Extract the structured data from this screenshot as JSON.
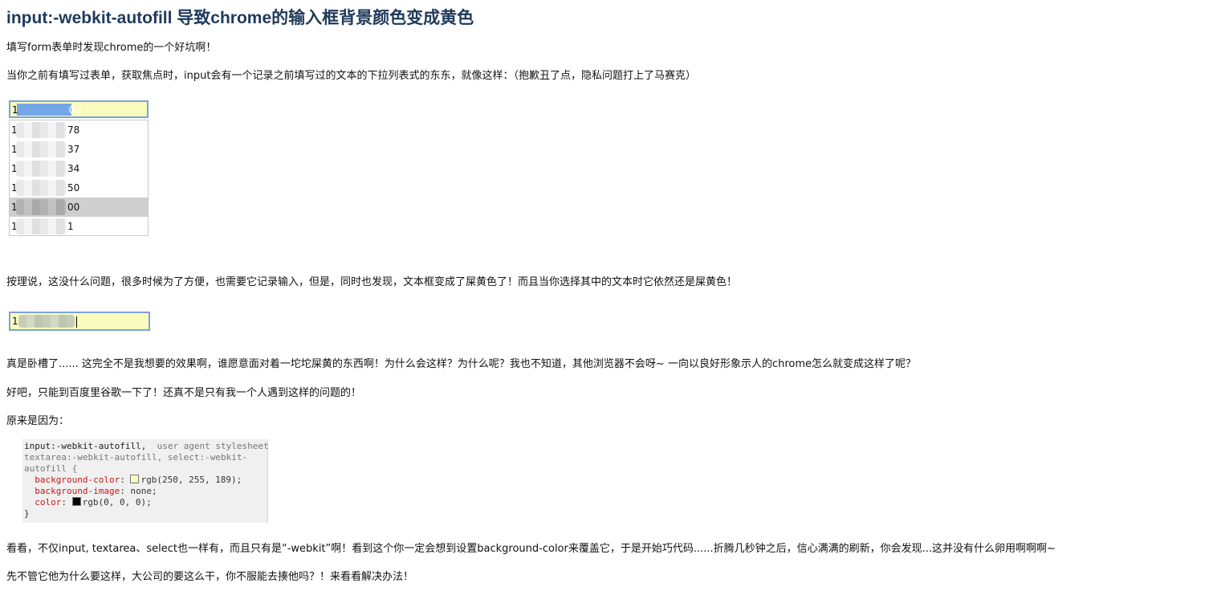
{
  "article": {
    "title": "input:-webkit-autofill 导致chrome的输入框背景颜色变成黄色",
    "p1": "填写form表单时发现chrome的一个好坑啊！",
    "p2": "当你之前有填写过表单，获取焦点时，input会有一个记录之前填写过的文本的下拉列表式的东东，就像这样：（抱歉丑了点，隐私问题打上了马赛克）",
    "p3": "按理说，这没什么问题，很多时候为了方便，也需要它记录输入，但是，同时也发现，文本框变成了屎黄色了！而且当你选择其中的文本时它依然还是屎黄色！",
    "p4": "真是卧槽了...... 这完全不是我想要的效果啊，谁愿意面对着一坨坨屎黄的东西啊！为什么会这样？为什么呢？我也不知道，其他浏览器不会呀~ 一向以良好形象示人的chrome怎么就变成这样了呢？",
    "p5": "好吧，只能到百度里谷歌一下了！还真不是只有我一个人遇到这样的问题的！",
    "p6": "原来是因为：",
    "p7": "看看，不仅input, textarea、select也一样有，而且只有是“-webkit”啊！看到这个你一定会想到设置background-color来覆盖它，于是开始巧代码......折腾几秒钟之后，信心满满的刷新，你会发现...这并没有什么卵用啊啊啊~",
    "p8": "先不管它他为什么要这样，大公司的要这么干，你不服能去揍他吗？！来看看解决办法！"
  },
  "autofill_demo": {
    "input_head": "1",
    "input_selected_tail": "00",
    "options": [
      {
        "head": "1",
        "tail": "78"
      },
      {
        "head": "1",
        "tail": "37"
      },
      {
        "head": "1",
        "tail": "34"
      },
      {
        "head": "1",
        "tail": "00"
      },
      {
        "head": "1",
        "tail": "1"
      },
      {
        "head": "1",
        "tail": "50"
      }
    ],
    "highlighted_index": 3,
    "autofill_bg": "#fafcbd",
    "focus_border": "#7aa3d8"
  },
  "second_input": {
    "head": "1"
  },
  "code": {
    "line1_selector": "input:-webkit-autofill,",
    "line1_source": "user agent stylesheet",
    "line2": "textarea:-webkit-autofill, select:-webkit-",
    "line3": "autofill {",
    "decl1_prop": "background-color",
    "decl1_val": "rgb(250, 255, 189);",
    "decl1_swatch": "#fafcbd",
    "decl2_prop": "background-image",
    "decl2_val": "none;",
    "decl3_prop": "color",
    "decl3_val": "rgb(0, 0, 0);",
    "decl3_swatch": "#000000",
    "close": "}"
  }
}
